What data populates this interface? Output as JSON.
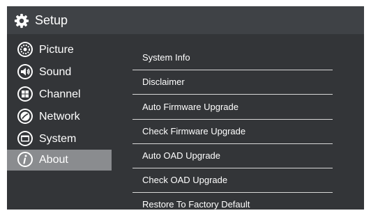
{
  "header": {
    "title": "Setup",
    "icon": "gear-icon"
  },
  "sidebar": {
    "selected": "About",
    "items": [
      {
        "label": "Picture",
        "icon": "picture-settings-icon"
      },
      {
        "label": "Sound",
        "icon": "speaker-icon"
      },
      {
        "label": "Channel",
        "icon": "channel-grid-icon"
      },
      {
        "label": "Network",
        "icon": "network-globe-icon"
      },
      {
        "label": "System",
        "icon": "system-screen-icon"
      },
      {
        "label": "About",
        "icon": "info-icon"
      }
    ]
  },
  "menu": {
    "items": [
      {
        "label": "System Info"
      },
      {
        "label": "Disclaimer"
      },
      {
        "label": "Auto Firmware Upgrade"
      },
      {
        "label": "Check Firmware Upgrade"
      },
      {
        "label": "Auto OAD Upgrade"
      },
      {
        "label": "Check OAD Upgrade"
      },
      {
        "label": "Restore To Factory Default"
      }
    ]
  },
  "colors": {
    "background": "#333538",
    "header": "#3f4246",
    "selected_item": "#8a8c8f",
    "text": "#ffffff",
    "divider": "#d8d8d8"
  }
}
